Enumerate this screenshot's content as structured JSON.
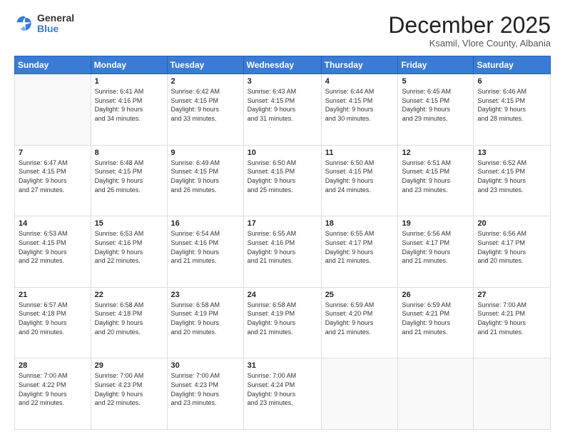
{
  "logo": {
    "general": "General",
    "blue": "Blue"
  },
  "title": "December 2025",
  "location": "Ksamil, Vlore County, Albania",
  "days_of_week": [
    "Sunday",
    "Monday",
    "Tuesday",
    "Wednesday",
    "Thursday",
    "Friday",
    "Saturday"
  ],
  "weeks": [
    [
      {
        "day": "",
        "info": ""
      },
      {
        "day": "1",
        "info": "Sunrise: 6:41 AM\nSunset: 4:16 PM\nDaylight: 9 hours\nand 34 minutes."
      },
      {
        "day": "2",
        "info": "Sunrise: 6:42 AM\nSunset: 4:15 PM\nDaylight: 9 hours\nand 33 minutes."
      },
      {
        "day": "3",
        "info": "Sunrise: 6:43 AM\nSunset: 4:15 PM\nDaylight: 9 hours\nand 31 minutes."
      },
      {
        "day": "4",
        "info": "Sunrise: 6:44 AM\nSunset: 4:15 PM\nDaylight: 9 hours\nand 30 minutes."
      },
      {
        "day": "5",
        "info": "Sunrise: 6:45 AM\nSunset: 4:15 PM\nDaylight: 9 hours\nand 29 minutes."
      },
      {
        "day": "6",
        "info": "Sunrise: 6:46 AM\nSunset: 4:15 PM\nDaylight: 9 hours\nand 28 minutes."
      }
    ],
    [
      {
        "day": "7",
        "info": "Sunrise: 6:47 AM\nSunset: 4:15 PM\nDaylight: 9 hours\nand 27 minutes."
      },
      {
        "day": "8",
        "info": "Sunrise: 6:48 AM\nSunset: 4:15 PM\nDaylight: 9 hours\nand 26 minutes."
      },
      {
        "day": "9",
        "info": "Sunrise: 6:49 AM\nSunset: 4:15 PM\nDaylight: 9 hours\nand 26 minutes."
      },
      {
        "day": "10",
        "info": "Sunrise: 6:50 AM\nSunset: 4:15 PM\nDaylight: 9 hours\nand 25 minutes."
      },
      {
        "day": "11",
        "info": "Sunrise: 6:50 AM\nSunset: 4:15 PM\nDaylight: 9 hours\nand 24 minutes."
      },
      {
        "day": "12",
        "info": "Sunrise: 6:51 AM\nSunset: 4:15 PM\nDaylight: 9 hours\nand 23 minutes."
      },
      {
        "day": "13",
        "info": "Sunrise: 6:52 AM\nSunset: 4:15 PM\nDaylight: 9 hours\nand 23 minutes."
      }
    ],
    [
      {
        "day": "14",
        "info": "Sunrise: 6:53 AM\nSunset: 4:15 PM\nDaylight: 9 hours\nand 22 minutes."
      },
      {
        "day": "15",
        "info": "Sunrise: 6:53 AM\nSunset: 4:16 PM\nDaylight: 9 hours\nand 22 minutes."
      },
      {
        "day": "16",
        "info": "Sunrise: 6:54 AM\nSunset: 4:16 PM\nDaylight: 9 hours\nand 21 minutes."
      },
      {
        "day": "17",
        "info": "Sunrise: 6:55 AM\nSunset: 4:16 PM\nDaylight: 9 hours\nand 21 minutes."
      },
      {
        "day": "18",
        "info": "Sunrise: 6:55 AM\nSunset: 4:17 PM\nDaylight: 9 hours\nand 21 minutes."
      },
      {
        "day": "19",
        "info": "Sunrise: 6:56 AM\nSunset: 4:17 PM\nDaylight: 9 hours\nand 21 minutes."
      },
      {
        "day": "20",
        "info": "Sunrise: 6:56 AM\nSunset: 4:17 PM\nDaylight: 9 hours\nand 20 minutes."
      }
    ],
    [
      {
        "day": "21",
        "info": "Sunrise: 6:57 AM\nSunset: 4:18 PM\nDaylight: 9 hours\nand 20 minutes."
      },
      {
        "day": "22",
        "info": "Sunrise: 6:58 AM\nSunset: 4:18 PM\nDaylight: 9 hours\nand 20 minutes."
      },
      {
        "day": "23",
        "info": "Sunrise: 6:58 AM\nSunset: 4:19 PM\nDaylight: 9 hours\nand 20 minutes."
      },
      {
        "day": "24",
        "info": "Sunrise: 6:58 AM\nSunset: 4:19 PM\nDaylight: 9 hours\nand 21 minutes."
      },
      {
        "day": "25",
        "info": "Sunrise: 6:59 AM\nSunset: 4:20 PM\nDaylight: 9 hours\nand 21 minutes."
      },
      {
        "day": "26",
        "info": "Sunrise: 6:59 AM\nSunset: 4:21 PM\nDaylight: 9 hours\nand 21 minutes."
      },
      {
        "day": "27",
        "info": "Sunrise: 7:00 AM\nSunset: 4:21 PM\nDaylight: 9 hours\nand 21 minutes."
      }
    ],
    [
      {
        "day": "28",
        "info": "Sunrise: 7:00 AM\nSunset: 4:22 PM\nDaylight: 9 hours\nand 22 minutes."
      },
      {
        "day": "29",
        "info": "Sunrise: 7:00 AM\nSunset: 4:23 PM\nDaylight: 9 hours\nand 22 minutes."
      },
      {
        "day": "30",
        "info": "Sunrise: 7:00 AM\nSunset: 4:23 PM\nDaylight: 9 hours\nand 23 minutes."
      },
      {
        "day": "31",
        "info": "Sunrise: 7:00 AM\nSunset: 4:24 PM\nDaylight: 9 hours\nand 23 minutes."
      },
      {
        "day": "",
        "info": ""
      },
      {
        "day": "",
        "info": ""
      },
      {
        "day": "",
        "info": ""
      }
    ]
  ]
}
